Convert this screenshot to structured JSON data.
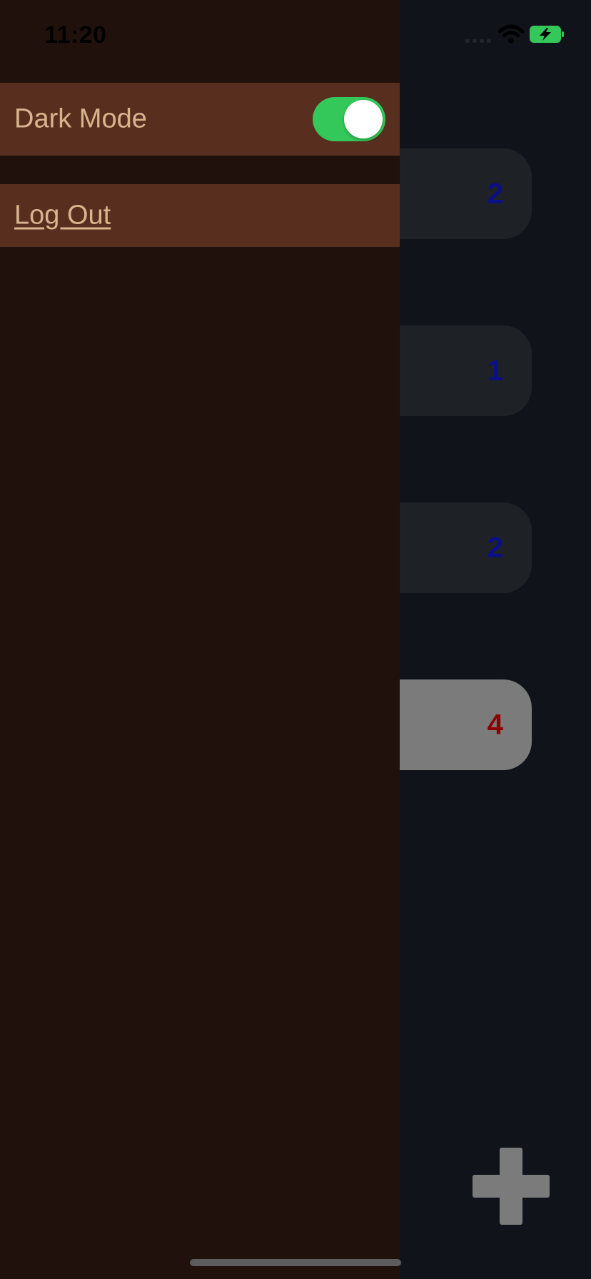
{
  "status_bar": {
    "time": "11:20"
  },
  "drawer": {
    "dark_mode": {
      "label": "Dark Mode",
      "enabled": true
    },
    "logout": {
      "label": "Log Out"
    }
  },
  "cards": [
    {
      "count": "2",
      "count_color": "#0a0f8a"
    },
    {
      "count": "1",
      "count_color": "#0a0f8a"
    },
    {
      "count": "2",
      "count_color": "#0a0f8a"
    },
    {
      "count": "4",
      "count_color": "#8b0000"
    }
  ],
  "colors": {
    "drawer_bg": "#21110c",
    "row_bg": "#582e1e",
    "row_text": "#d8b48e",
    "toggle_on": "#34c759",
    "battery_green": "#34c759"
  },
  "icons": {
    "add": "plus-icon",
    "wifi": "wifi-icon",
    "battery": "battery-charging-icon",
    "signal": "cellular-signal-icon"
  }
}
